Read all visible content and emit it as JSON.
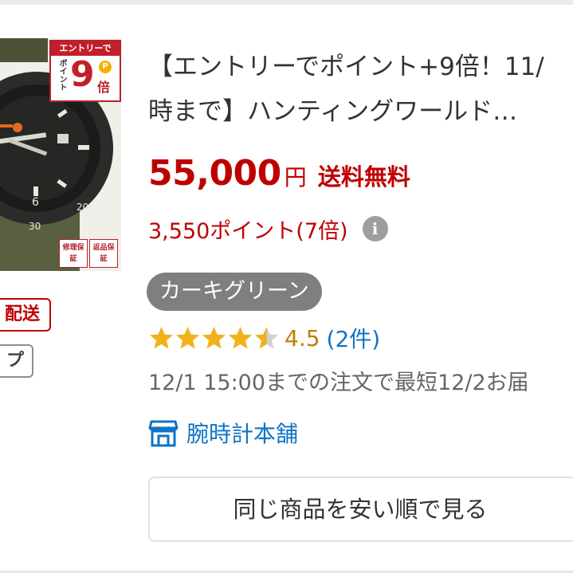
{
  "product": {
    "image_badge": {
      "entry_label": "エントリーで",
      "point_label": "ポイント",
      "multiplier": "9",
      "p_mark": "P",
      "times_label": "倍"
    },
    "guarantees": [
      "修理保証",
      "返品保証"
    ],
    "title_line1": "【エントリーでポイント+9倍！11/",
    "title_line2": "時まで】ハンティングワールド…",
    "price": "55,000",
    "currency": "円",
    "free_shipping": "送料無料",
    "points": "3,550ポイント(7倍)",
    "info_icon_glyph": "i",
    "variant": "カーキグリーン",
    "rating": {
      "stars": 4.5,
      "value": "4.5",
      "count": "(2件)",
      "star_color": "#f0b11b",
      "empty_star_color": "#d0d0d0"
    },
    "delivery": "12/1 15:00までの注文で最短12/2お届",
    "shop": {
      "icon": "store-icon",
      "name": "腕時計本舗"
    },
    "cheapest_button": "同じ商品を安い順で見る"
  },
  "left_tags": {
    "shipping_tag": "配送",
    "shop_tag": "プ"
  },
  "colors": {
    "price_red": "#bf0000",
    "link_blue": "#0f73c6",
    "chip_gray": "#7f7f7f"
  }
}
